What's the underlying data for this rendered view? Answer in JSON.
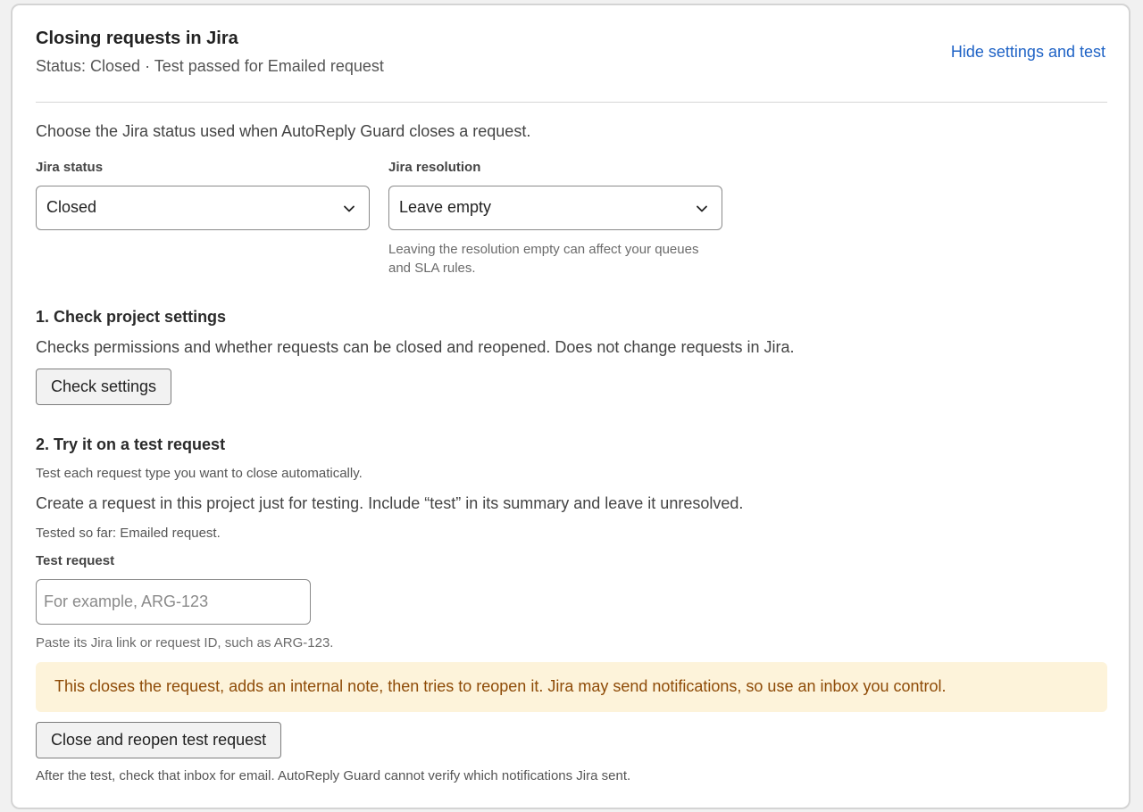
{
  "header": {
    "title": "Closing requests in Jira",
    "status": "Status: Closed · Test passed for Emailed request",
    "hide_link": "Hide settings and test"
  },
  "intro": "Choose the Jira status used when AutoReply Guard closes a request.",
  "jira_status": {
    "label": "Jira status",
    "value": "Closed"
  },
  "jira_resolution": {
    "label": "Jira resolution",
    "value": "Leave empty",
    "help": "Leaving the resolution empty can affect your queues and SLA rules."
  },
  "step1": {
    "heading": "1. Check project settings",
    "description": "Checks permissions and whether requests can be closed and reopened. Does not change requests in Jira.",
    "button": "Check settings"
  },
  "step2": {
    "heading": "2. Try it on a test request",
    "note": "Test each request type you want to close automatically.",
    "description": "Create a request in this project just for testing. Include “test” in its summary and leave it unresolved.",
    "tested": "Tested so far: Emailed request.",
    "input_label": "Test request",
    "input_value": "",
    "input_placeholder": "For example, ARG-123",
    "input_help": "Paste its Jira link or request ID, such as ARG-123.",
    "warning": "This closes the request, adds an internal note, then tries to reopen it. Jira may send notifications, so use an inbox you control.",
    "button": "Close and reopen test request",
    "footer": "After the test, check that inbox for email. AutoReply Guard cannot verify which notifications Jira sent."
  },
  "colors": {
    "link": "#1f63c6",
    "warning_bg": "#fdf3da",
    "warning_text": "#8e4b07"
  },
  "icons": {
    "select_chevron": "chevron-down-icon"
  }
}
